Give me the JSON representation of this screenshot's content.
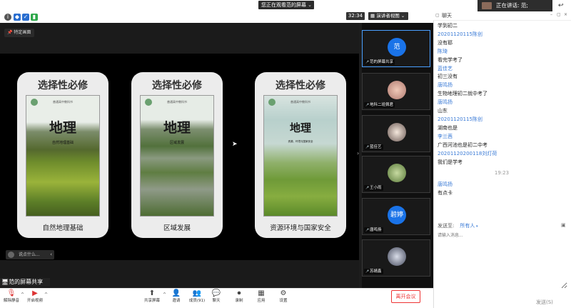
{
  "top": {
    "viewing_banner": "您正在观看范的屏幕",
    "timer": "32:34",
    "view_mode": "演讲者视图",
    "speaking": "正在讲话: 范;"
  },
  "stage": {
    "view_option": "特定画面",
    "slide_cards": [
      {
        "title": "选择性必修",
        "cover_title": "地理",
        "cover_topic": "自然地理基础",
        "footer": "自然地理基础"
      },
      {
        "title": "选择性必修",
        "cover_title": "地理",
        "cover_topic": "区域发展",
        "footer": "区域发展"
      },
      {
        "title": "选择性必修",
        "cover_title": "地理",
        "cover_topic": "资源、环境与国家安全",
        "footer": "资源环境与国家安全"
      }
    ],
    "cover_publisher": "普通高中教科书",
    "say_placeholder": "说点什么...",
    "screen_share_label": "范的屏幕共享"
  },
  "gallery": [
    {
      "name": "范的屏幕共享",
      "avatar": "范",
      "avatar_color": "#1a73e8"
    },
    {
      "name": "地科二班佩君"
    },
    {
      "name": "蓝佳艺"
    },
    {
      "name": "王小雨"
    },
    {
      "name": "唐鸣扬",
      "avatar": "碧婷",
      "avatar_color": "#1a73e8"
    },
    {
      "name": "苏婧鑫"
    }
  ],
  "chat": {
    "title": "聊天",
    "messages": [
      {
        "type": "text",
        "text": "学到初二"
      },
      {
        "type": "sender",
        "text": "20201120115陈创"
      },
      {
        "type": "text",
        "text": "没有耶"
      },
      {
        "type": "sender",
        "text": "陈琦"
      },
      {
        "type": "text",
        "text": "看完学考了"
      },
      {
        "type": "sender",
        "text": "蓝佳艺"
      },
      {
        "type": "text",
        "text": "初三没有"
      },
      {
        "type": "sender",
        "text": "唐鸣扬"
      },
      {
        "type": "text",
        "text": "生物地理初二就中考了"
      },
      {
        "type": "sender",
        "text": "唐鸣扬"
      },
      {
        "type": "text",
        "text": "山东"
      },
      {
        "type": "sender",
        "text": "20201120115陈创"
      },
      {
        "type": "text",
        "text": "湖南也是"
      },
      {
        "type": "sender",
        "text": "李兰茜"
      },
      {
        "type": "text",
        "text": "广西河池也是初二中考"
      },
      {
        "type": "sender",
        "text": "20201120200118刘灯荷"
      },
      {
        "type": "text",
        "text": "我们是学考"
      },
      {
        "type": "time",
        "text": "19:23"
      },
      {
        "type": "sender",
        "text": "唐鸣扬"
      },
      {
        "type": "text",
        "text": "有点卡"
      }
    ],
    "send_to_label": "发送至:",
    "send_to_value": "所有人",
    "input_placeholder": "请输入消息...",
    "send_label": "发送(S)"
  },
  "toolbar": {
    "mute": "解除静音",
    "video": "开启视频",
    "share": "共享屏幕",
    "invite": "邀请",
    "participants": "成员(91)",
    "chat": "聊天",
    "record": "录制",
    "apps": "应用",
    "settings": "设置",
    "leave": "离开会议"
  }
}
